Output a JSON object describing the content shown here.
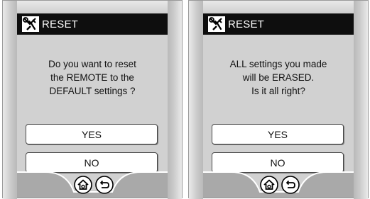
{
  "screens": [
    {
      "title": "RESET",
      "message_lines": [
        "Do you want to reset",
        "the REMOTE to the",
        "DEFAULT settings ?"
      ],
      "yes_label": "YES",
      "no_label": "NO",
      "nav_icons": [
        "home-icon",
        "back-icon"
      ]
    },
    {
      "title": "RESET",
      "message_lines": [
        "ALL settings you made",
        "will be ERASED.",
        "Is it all right?"
      ],
      "yes_label": "YES",
      "no_label": "NO",
      "nav_icons": [
        "home-icon",
        "back-icon"
      ]
    }
  ],
  "colors": {
    "titlebar": "#0e0e0e",
    "screen_bg": "#d1d1d1",
    "button_bg": "#ffffff"
  }
}
